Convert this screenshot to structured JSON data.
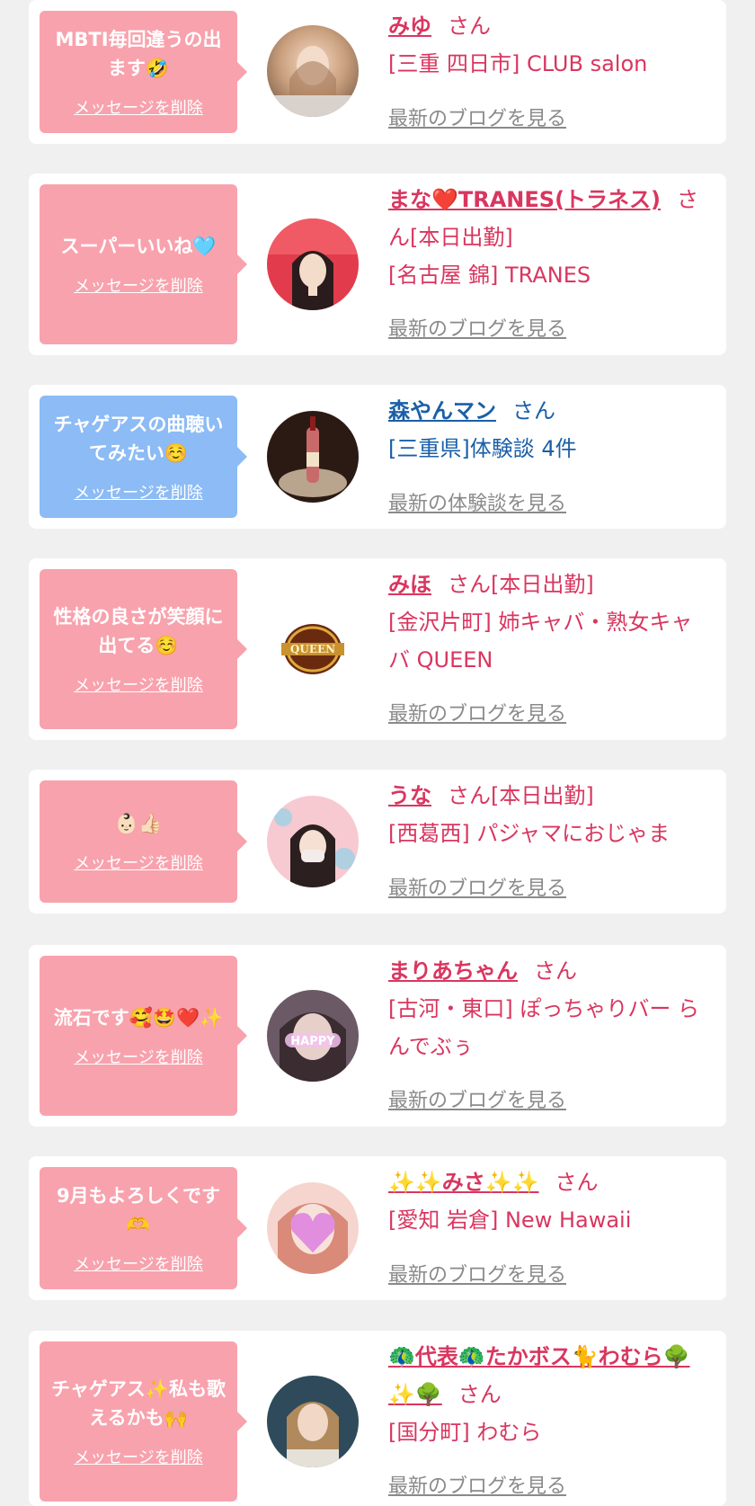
{
  "cards": [
    {
      "message": "MBTI毎回違うの出ます🤣",
      "delete_label": "メッセージを削除",
      "name": "みゆ",
      "honorific": "さん",
      "shop": "[三重 四日市] CLUB salon",
      "link": "最新のブログを見る"
    },
    {
      "message": "スーパーいいね🩵",
      "delete_label": "メッセージを削除",
      "name": "まな❤️TRANES(トラネス)",
      "honorific": "さん[本日出勤]",
      "shop": "[名古屋 錦] TRANES",
      "link": "最新のブログを見る"
    },
    {
      "message": "チャゲアスの曲聴いてみたい☺️",
      "delete_label": "メッセージを削除",
      "name": "森やんマン",
      "honorific": "さん",
      "shop": "[三重県]体験談 4件",
      "link": "最新の体験談を見る"
    },
    {
      "message": "性格の良さが笑顔に出てる☺️",
      "delete_label": "メッセージを削除",
      "name": "みほ",
      "honorific": "さん[本日出勤]",
      "shop": "[金沢片町] 姉キャバ・熟女キャバ QUEEN",
      "link": "最新のブログを見る"
    },
    {
      "message": "👶🏻👍🏻",
      "delete_label": "メッセージを削除",
      "name": "うな",
      "honorific": "さん[本日出勤]",
      "shop": "[西葛西] パジャマにおじゃま",
      "link": "最新のブログを見る"
    },
    {
      "message": "流石です🥰🤩❤️✨",
      "delete_label": "メッセージを削除",
      "name": "まりあちゃん",
      "honorific": "さん",
      "shop": "[古河・東口] ぽっちゃりバー らんでぶぅ",
      "link": "最新のブログを見る"
    },
    {
      "message": "9月もよろしくです🫶",
      "delete_label": "メッセージを削除",
      "name": "✨✨みさ✨✨",
      "honorific": "さん",
      "shop": "[愛知 岩倉] New Hawaii",
      "link": "最新のブログを見る"
    },
    {
      "message": "チャゲアス✨私も歌えるかも🙌",
      "delete_label": "メッセージを削除",
      "name": "🦚代表🦚たかボス🐈わむら🌳✨🌳",
      "honorific": "さん",
      "shop": "[国分町] わむら",
      "link": "最新のブログを見る"
    }
  ],
  "colors": {
    "background": "#f0f0f0",
    "card": "#ffffff",
    "bubble_pink": "#f8a2ad",
    "bubble_blue": "#8cbbf5",
    "text_pink": "#d9365f",
    "text_blue": "#1a5fa8",
    "link_gray": "#8a8a8a"
  },
  "icons": {
    "avatar_1": "photo-avatar",
    "avatar_4": "queen-logo-avatar"
  }
}
